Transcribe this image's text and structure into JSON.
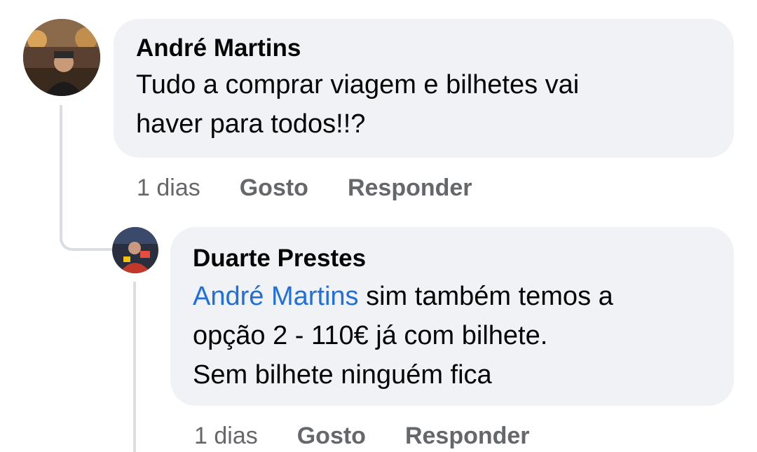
{
  "comment": {
    "author": "André Martins",
    "text_line1": "Tudo a comprar viagem e bilhetes vai",
    "text_line2": "haver para todos!!?",
    "time": "1 dias",
    "like_label": "Gosto",
    "reply_label": "Responder"
  },
  "reply": {
    "author": "Duarte Prestes",
    "mention": "André Martins",
    "text_line1_rest": " sim também temos a",
    "text_line2": "opção 2 - 110€ já com bilhete.",
    "text_line3": "Sem bilhete ninguém fica",
    "time": "1 dias",
    "like_label": "Gosto",
    "reply_label": "Responder"
  },
  "colors": {
    "bubble_bg": "#f0f2f5",
    "mention": "#216fdb",
    "meta_text": "#65676b",
    "thread_line": "#dadde1"
  }
}
